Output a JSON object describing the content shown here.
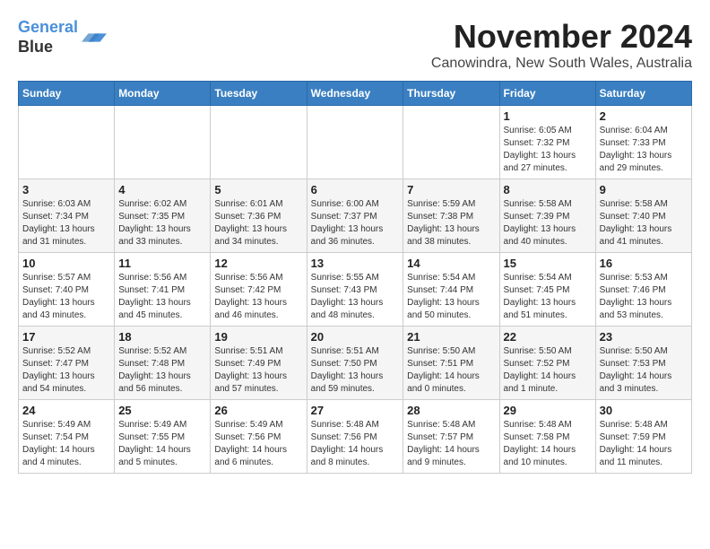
{
  "header": {
    "logo_line1": "General",
    "logo_line2": "Blue",
    "month": "November 2024",
    "location": "Canowindra, New South Wales, Australia"
  },
  "weekdays": [
    "Sunday",
    "Monday",
    "Tuesday",
    "Wednesday",
    "Thursday",
    "Friday",
    "Saturday"
  ],
  "weeks": [
    [
      {
        "day": "",
        "info": ""
      },
      {
        "day": "",
        "info": ""
      },
      {
        "day": "",
        "info": ""
      },
      {
        "day": "",
        "info": ""
      },
      {
        "day": "",
        "info": ""
      },
      {
        "day": "1",
        "info": "Sunrise: 6:05 AM\nSunset: 7:32 PM\nDaylight: 13 hours\nand 27 minutes."
      },
      {
        "day": "2",
        "info": "Sunrise: 6:04 AM\nSunset: 7:33 PM\nDaylight: 13 hours\nand 29 minutes."
      }
    ],
    [
      {
        "day": "3",
        "info": "Sunrise: 6:03 AM\nSunset: 7:34 PM\nDaylight: 13 hours\nand 31 minutes."
      },
      {
        "day": "4",
        "info": "Sunrise: 6:02 AM\nSunset: 7:35 PM\nDaylight: 13 hours\nand 33 minutes."
      },
      {
        "day": "5",
        "info": "Sunrise: 6:01 AM\nSunset: 7:36 PM\nDaylight: 13 hours\nand 34 minutes."
      },
      {
        "day": "6",
        "info": "Sunrise: 6:00 AM\nSunset: 7:37 PM\nDaylight: 13 hours\nand 36 minutes."
      },
      {
        "day": "7",
        "info": "Sunrise: 5:59 AM\nSunset: 7:38 PM\nDaylight: 13 hours\nand 38 minutes."
      },
      {
        "day": "8",
        "info": "Sunrise: 5:58 AM\nSunset: 7:39 PM\nDaylight: 13 hours\nand 40 minutes."
      },
      {
        "day": "9",
        "info": "Sunrise: 5:58 AM\nSunset: 7:40 PM\nDaylight: 13 hours\nand 41 minutes."
      }
    ],
    [
      {
        "day": "10",
        "info": "Sunrise: 5:57 AM\nSunset: 7:40 PM\nDaylight: 13 hours\nand 43 minutes."
      },
      {
        "day": "11",
        "info": "Sunrise: 5:56 AM\nSunset: 7:41 PM\nDaylight: 13 hours\nand 45 minutes."
      },
      {
        "day": "12",
        "info": "Sunrise: 5:56 AM\nSunset: 7:42 PM\nDaylight: 13 hours\nand 46 minutes."
      },
      {
        "day": "13",
        "info": "Sunrise: 5:55 AM\nSunset: 7:43 PM\nDaylight: 13 hours\nand 48 minutes."
      },
      {
        "day": "14",
        "info": "Sunrise: 5:54 AM\nSunset: 7:44 PM\nDaylight: 13 hours\nand 50 minutes."
      },
      {
        "day": "15",
        "info": "Sunrise: 5:54 AM\nSunset: 7:45 PM\nDaylight: 13 hours\nand 51 minutes."
      },
      {
        "day": "16",
        "info": "Sunrise: 5:53 AM\nSunset: 7:46 PM\nDaylight: 13 hours\nand 53 minutes."
      }
    ],
    [
      {
        "day": "17",
        "info": "Sunrise: 5:52 AM\nSunset: 7:47 PM\nDaylight: 13 hours\nand 54 minutes."
      },
      {
        "day": "18",
        "info": "Sunrise: 5:52 AM\nSunset: 7:48 PM\nDaylight: 13 hours\nand 56 minutes."
      },
      {
        "day": "19",
        "info": "Sunrise: 5:51 AM\nSunset: 7:49 PM\nDaylight: 13 hours\nand 57 minutes."
      },
      {
        "day": "20",
        "info": "Sunrise: 5:51 AM\nSunset: 7:50 PM\nDaylight: 13 hours\nand 59 minutes."
      },
      {
        "day": "21",
        "info": "Sunrise: 5:50 AM\nSunset: 7:51 PM\nDaylight: 14 hours\nand 0 minutes."
      },
      {
        "day": "22",
        "info": "Sunrise: 5:50 AM\nSunset: 7:52 PM\nDaylight: 14 hours\nand 1 minute."
      },
      {
        "day": "23",
        "info": "Sunrise: 5:50 AM\nSunset: 7:53 PM\nDaylight: 14 hours\nand 3 minutes."
      }
    ],
    [
      {
        "day": "24",
        "info": "Sunrise: 5:49 AM\nSunset: 7:54 PM\nDaylight: 14 hours\nand 4 minutes."
      },
      {
        "day": "25",
        "info": "Sunrise: 5:49 AM\nSunset: 7:55 PM\nDaylight: 14 hours\nand 5 minutes."
      },
      {
        "day": "26",
        "info": "Sunrise: 5:49 AM\nSunset: 7:56 PM\nDaylight: 14 hours\nand 6 minutes."
      },
      {
        "day": "27",
        "info": "Sunrise: 5:48 AM\nSunset: 7:56 PM\nDaylight: 14 hours\nand 8 minutes."
      },
      {
        "day": "28",
        "info": "Sunrise: 5:48 AM\nSunset: 7:57 PM\nDaylight: 14 hours\nand 9 minutes."
      },
      {
        "day": "29",
        "info": "Sunrise: 5:48 AM\nSunset: 7:58 PM\nDaylight: 14 hours\nand 10 minutes."
      },
      {
        "day": "30",
        "info": "Sunrise: 5:48 AM\nSunset: 7:59 PM\nDaylight: 14 hours\nand 11 minutes."
      }
    ]
  ]
}
